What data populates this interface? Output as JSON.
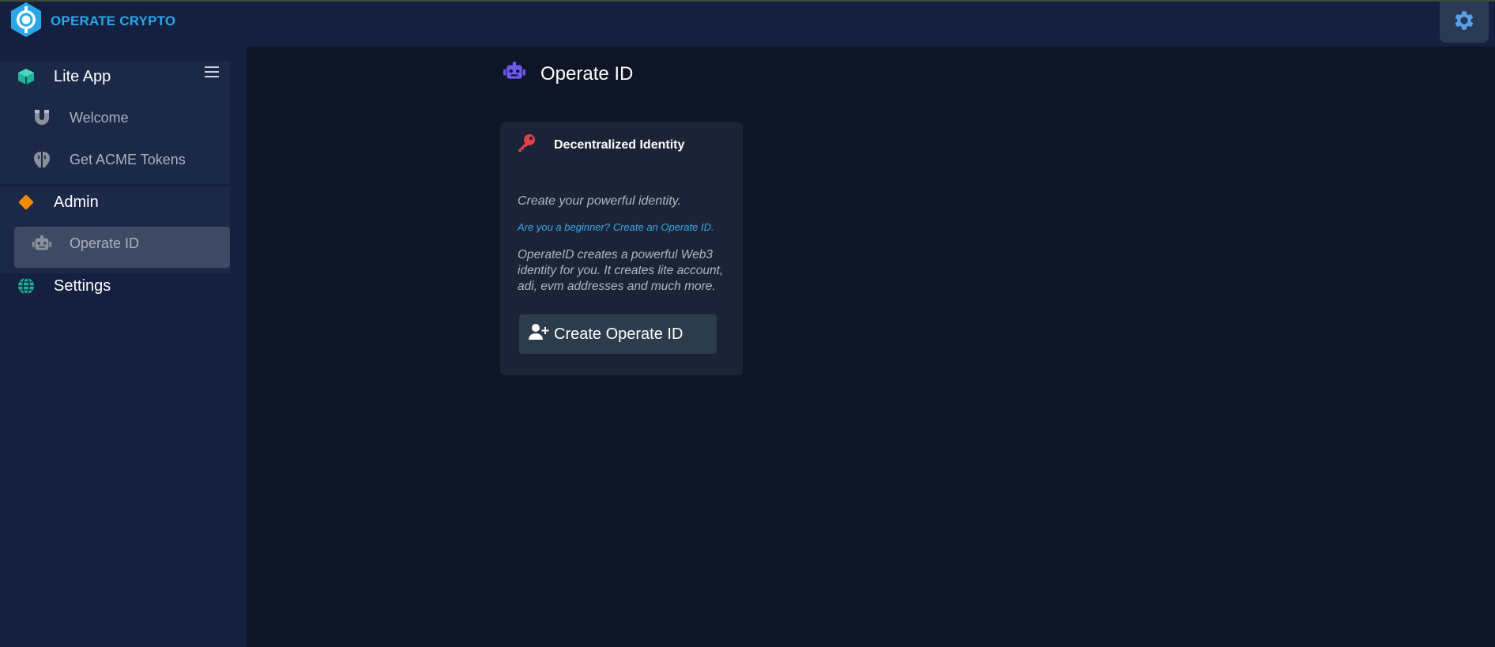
{
  "app": {
    "brand": "OPERATE CRYPTO"
  },
  "sidebar": {
    "sections": [
      {
        "label": "Lite App",
        "icon": "cube-icon",
        "color": "#1fb39a",
        "items": [
          {
            "label": "Welcome",
            "icon": "magnet-icon"
          },
          {
            "label": "Get ACME Tokens",
            "icon": "brain-icon"
          }
        ]
      },
      {
        "label": "Admin",
        "icon": "diamond-icon",
        "color": "#f08a00",
        "items": [
          {
            "label": "Operate ID",
            "icon": "robot-icon",
            "active": true
          }
        ]
      },
      {
        "label": "Settings",
        "icon": "globe-icon",
        "color": "#1fb39a",
        "items": []
      }
    ]
  },
  "main": {
    "title": "Operate ID",
    "card": {
      "title": "Decentralized Identity",
      "subtitle": "Create your powerful identity.",
      "link": "Are you a beginner? Create an Operate ID.",
      "description": "OperateID creates a powerful Web3 identity for you. It creates lite account, adi, evm addresses and much more.",
      "button_label": "Create Operate ID"
    }
  },
  "colors": {
    "accent": "#2aa7e8",
    "link": "#3aa8e8",
    "key": "#e0404a",
    "robot": "#6b5cf0"
  }
}
